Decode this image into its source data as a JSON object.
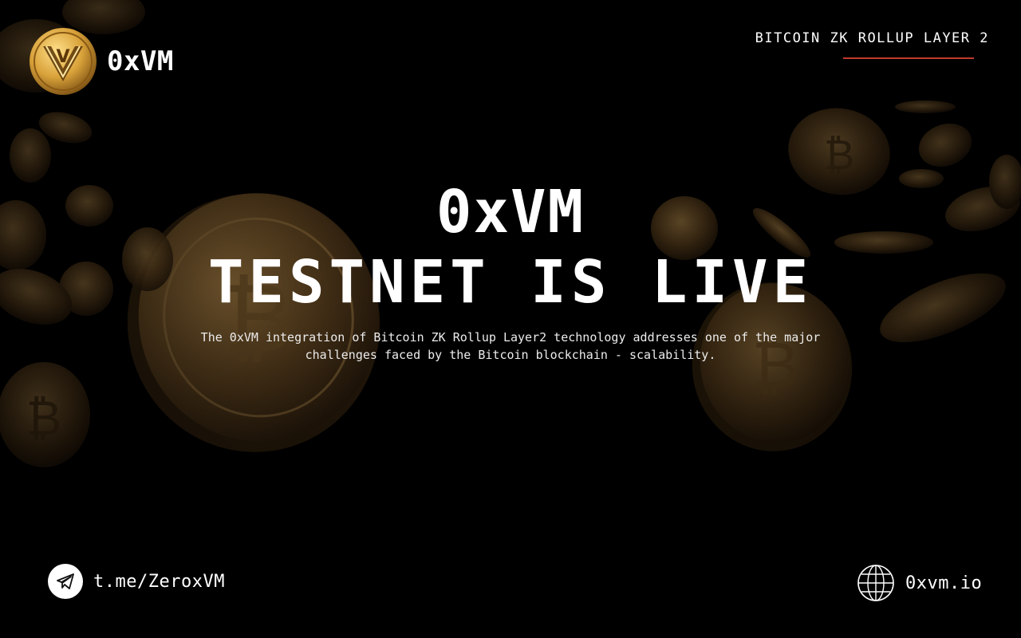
{
  "brand": {
    "name": "0xVM",
    "logo_letter": "V",
    "logo_icon": "bitcoin-v-logo-icon"
  },
  "header": {
    "tagline": "BITCOIN ZK ROLLUP LAYER 2"
  },
  "hero": {
    "line1": "0xVM",
    "line2": "TESTNET IS LIVE",
    "description_line1": "The 0xVM integration of Bitcoin ZK Rollup Layer2 technology addresses one of the major",
    "description_line2": "challenges faced by the Bitcoin blockchain - scalability."
  },
  "footer": {
    "telegram": {
      "icon": "telegram-icon",
      "link": "t.me/ZeroxVM"
    },
    "website": {
      "icon": "globe-icon",
      "link": "0xvm.io"
    }
  },
  "colors": {
    "background": "#000000",
    "accent": "#c0392b",
    "gold": "#c99a3a",
    "text": "#ffffff"
  },
  "decor": {
    "coin_symbol": "₿"
  }
}
